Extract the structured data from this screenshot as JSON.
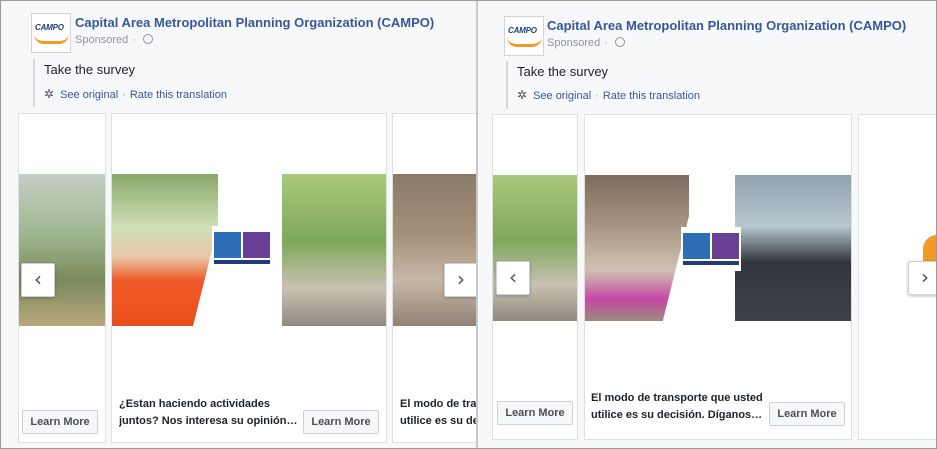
{
  "page": {
    "name": "Capital Area Metropolitan Planning Organization (CAMPO)",
    "sponsored": "Sponsored",
    "logo_text": "CAMPO"
  },
  "post": {
    "text": "Take the survey",
    "see_original": "See original",
    "rate_translation": "Rate this translation",
    "separator": "·"
  },
  "captions": {
    "card_a_line1": "¿Estan haciendo actividades",
    "card_a_line2": "juntos? Nos interesa su opinión…",
    "card_b_line1": "El modo de transporte que usted",
    "card_b_line2": "utilice es su decisión. Díganos…",
    "card_c_line1": "El modo de tra",
    "card_c_line2": "utilice es su de"
  },
  "cta": {
    "learn_more": "Learn More"
  },
  "icons": {
    "prev": "‹",
    "next": "›",
    "gear": "✲"
  },
  "colors": {
    "link": "#365899",
    "meta": "#90949c",
    "accent_orange": "#f39a26"
  }
}
